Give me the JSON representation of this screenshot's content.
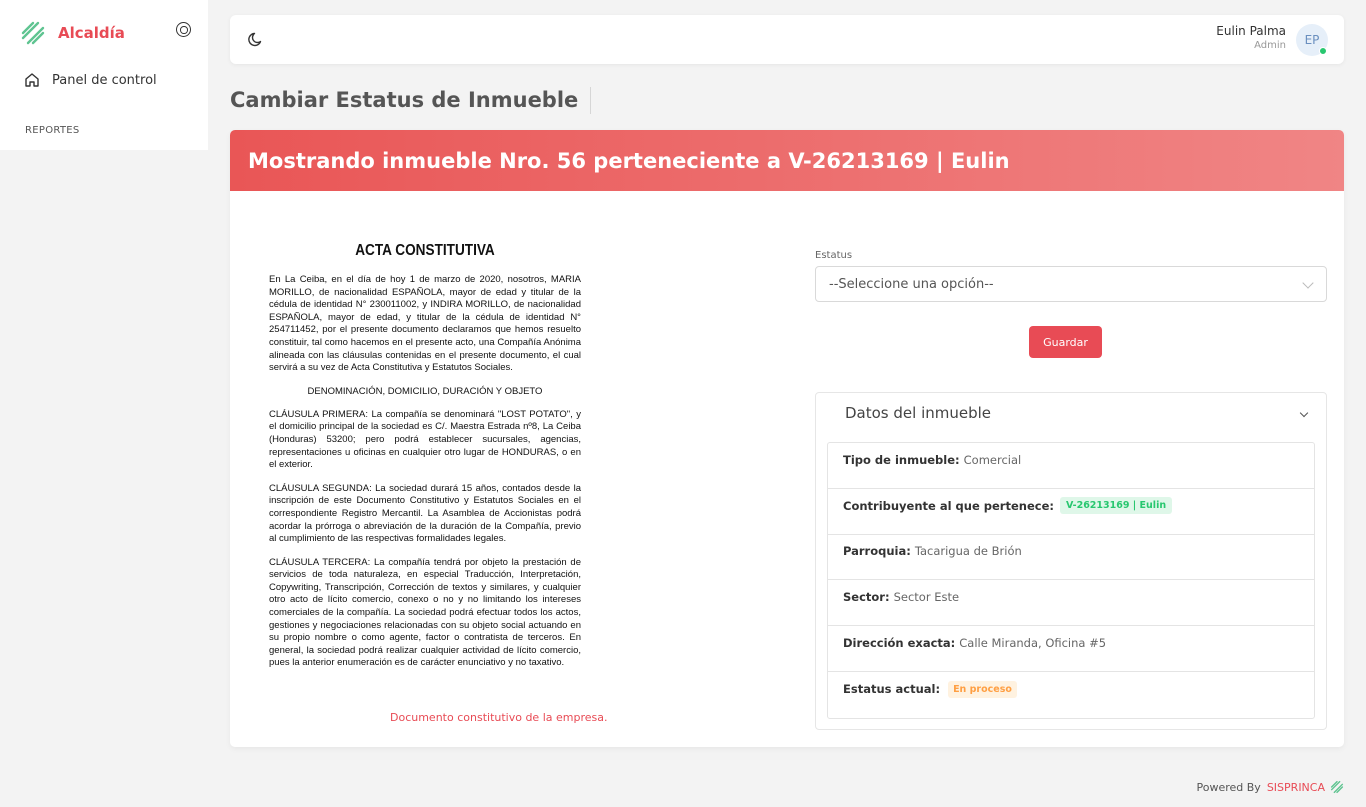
{
  "brand": {
    "name": "Alcaldía",
    "accent": "#e84b55",
    "logo_color": "#5fc491"
  },
  "sidebar": {
    "items": [
      {
        "label": "Panel de control",
        "icon": "home-icon"
      }
    ],
    "section_label": "REPORTES"
  },
  "topbar": {
    "theme_icon": "moon-icon",
    "user": {
      "name": "Eulin Palma",
      "role": "Admin",
      "initials": "EP",
      "status_color": "#28c76f"
    }
  },
  "page": {
    "title": "Cambiar Estatus de Inmueble"
  },
  "card": {
    "header": "Mostrando inmueble Nro. 56 perteneciente a V-26213169 | Eulin",
    "document": {
      "title": "ACTA CONSTITUTIVA",
      "intro": "En La Ceiba, en el día de hoy 1 de marzo de 2020, nosotros, MARIA MORILLO, de nacionalidad ESPAÑOLA, mayor de edad y titular de la cédula de identidad N° 230011002, y INDIRA MORILLO, de nacionalidad ESPAÑOLA, mayor de edad, y titular de la cédula de identidad N° 254711452, por el presente documento declaramos que hemos resuelto constituir, tal como hacemos en el presente acto, una Compañía Anónima alineada con las cláusulas contenidas en el presente documento, el cual servirá a su vez de Acta Constitutiva y Estatutos Sociales.",
      "subtitle": "DENOMINACIÓN, DOMICILIO, DURACIÓN Y OBJETO",
      "clause1": "CLÁUSULA PRIMERA: La compañía se denominará \"LOST POTATO\", y el domicilio principal de la sociedad es C/. Maestra Estrada nº8, La Ceiba (Honduras) 53200; pero podrá establecer sucursales, agencias, representaciones u oficinas en cualquier otro lugar de HONDURAS, o en el exterior.",
      "clause2": "CLÁUSULA SEGUNDA: La sociedad durará 15 años, contados desde la inscripción de este Documento Constitutivo y Estatutos Sociales en el correspondiente Registro Mercantil. La Asamblea de Accionistas podrá acordar la prórroga o abreviación de la duración de la Compañía, previo al cumplimiento de las respectivas formalidades legales.",
      "clause3": "CLÁUSULA TERCERA: La compañía tendrá por objeto la prestación de servicios de toda naturaleza, en especial Traducción, Interpretación, Copywriting, Transcripción, Corrección de textos y similares, y cualquier otro acto de lícito comercio, conexo o no y no limitando los intereses comerciales de la compañía. La sociedad podrá efectuar todos los actos, gestiones y negociaciones relacionadas con su objeto social actuando en su propio nombre o como agente, factor o contratista de terceros. En general, la sociedad podrá realizar cualquier actividad de lícito comercio, pues la anterior enumeración es de carácter enunciativo y no taxativo.",
      "caption": "Documento constitutivo de la empresa."
    },
    "form": {
      "status_label": "Estatus",
      "status_value": "--Seleccione una opción--",
      "save_label": "Guardar"
    },
    "details": {
      "title": "Datos del inmueble",
      "rows": {
        "tipo": {
          "label": "Tipo de inmueble:",
          "value": "Comercial"
        },
        "contribuyente": {
          "label": "Contribuyente al que pertenece:",
          "value": "V-26213169 | Eulin"
        },
        "parroquia": {
          "label": "Parroquia:",
          "value": "Tacarigua de Brión"
        },
        "sector": {
          "label": "Sector:",
          "value": "Sector Este"
        },
        "direccion": {
          "label": "Dirección exacta:",
          "value": "Calle Miranda, Oficina #5"
        },
        "estatus": {
          "label": "Estatus actual:",
          "value": "En proceso"
        }
      }
    }
  },
  "footer": {
    "powered": "Powered By",
    "brand": "SISPRINCA"
  }
}
